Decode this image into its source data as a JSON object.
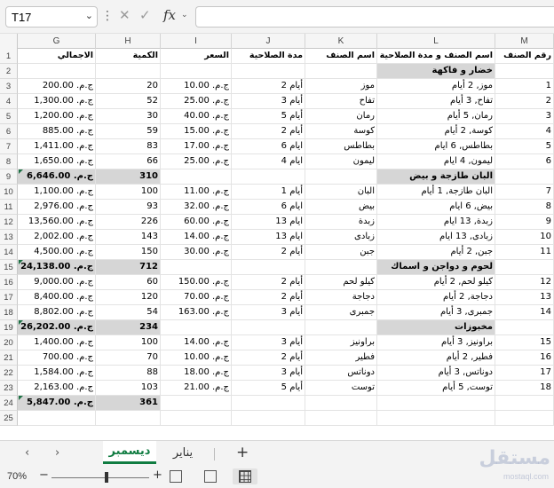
{
  "formula_bar": {
    "name_box": "T17",
    "fx": "fx",
    "formula": ""
  },
  "columns": [
    "G",
    "H",
    "I",
    "J",
    "K",
    "L",
    "M"
  ],
  "header_row": {
    "G": "الاجمالي",
    "H": "الكمية",
    "I": "السعر",
    "J": "مدة الصلاحية",
    "K": "اسم الصنف",
    "L": "اسم الصنف و مدة الصلاحية",
    "M": "رقم الصنف"
  },
  "rows": [
    {
      "n": "1",
      "type": "header"
    },
    {
      "n": "2",
      "type": "section",
      "L": "خضار و فاكهة"
    },
    {
      "n": "3",
      "type": "item",
      "G": "ج.م. 200.00",
      "H": "20",
      "I": "ج.م. 10.00",
      "J": "2 أيام",
      "K": "موز",
      "L": "موز, 2 أيام",
      "M": "1"
    },
    {
      "n": "4",
      "type": "item",
      "G": "ج.م. 1,300.00",
      "H": "52",
      "I": "ج.م. 25.00",
      "J": "3 أيام",
      "K": "تفاح",
      "L": "تفاح, 3 أيام",
      "M": "2"
    },
    {
      "n": "5",
      "type": "item",
      "G": "ج.م. 1,200.00",
      "H": "30",
      "I": "ج.م. 40.00",
      "J": "5 أيام",
      "K": "رمان",
      "L": "رمان, 5 أيام",
      "M": "3"
    },
    {
      "n": "6",
      "type": "item",
      "G": "ج.م. 885.00",
      "H": "59",
      "I": "ج.م. 15.00",
      "J": "2 أيام",
      "K": "كوسة",
      "L": "كوسة, 2 أيام",
      "M": "4"
    },
    {
      "n": "7",
      "type": "item",
      "G": "ج.م. 1,411.00",
      "H": "83",
      "I": "ج.م. 17.00",
      "J": "6 ايام",
      "K": "بطاطس",
      "L": "بطاطس, 6 ايام",
      "M": "5"
    },
    {
      "n": "8",
      "type": "item",
      "G": "ج.م. 1,650.00",
      "H": "66",
      "I": "ج.م. 25.00",
      "J": "4 ايام",
      "K": "ليمون",
      "L": "ليمون, 4 ايام",
      "M": "6"
    },
    {
      "n": "9",
      "type": "total",
      "G": "ج.م. 6,646.00",
      "H": "310",
      "L": "البان طازجة و بيض"
    },
    {
      "n": "10",
      "type": "item",
      "G": "ج.م. 1,100.00",
      "H": "100",
      "I": "ج.م. 11.00",
      "J": "1 أيام",
      "K": "البان",
      "L": "البان طازجة, 1 أيام",
      "M": "7"
    },
    {
      "n": "11",
      "type": "item",
      "G": "ج.م. 2,976.00",
      "H": "93",
      "I": "ج.م. 32.00",
      "J": "6 ايام",
      "K": "بيض",
      "L": "بيض, 6 ايام",
      "M": "8"
    },
    {
      "n": "12",
      "type": "item",
      "G": "ج.م. 13,560.00",
      "H": "226",
      "I": "ج.م. 60.00",
      "J": "13 ايام",
      "K": "زبدة",
      "L": "زبدة, 13 ايام",
      "M": "9"
    },
    {
      "n": "13",
      "type": "item",
      "G": "ج.م. 2,002.00",
      "H": "143",
      "I": "ج.م. 14.00",
      "J": "13 ايام",
      "K": "زبادى",
      "L": "زبادى, 13 ايام",
      "M": "10"
    },
    {
      "n": "14",
      "type": "item",
      "G": "ج.م. 4,500.00",
      "H": "150",
      "I": "ج.م. 30.00",
      "J": "2 أيام",
      "K": "جبن",
      "L": "جبن, 2 أيام",
      "M": "11"
    },
    {
      "n": "15",
      "type": "total",
      "G": "ج.م. 24,138.00",
      "H": "712",
      "L": "لحوم و دواجن و اسماك"
    },
    {
      "n": "16",
      "type": "item",
      "G": "ج.م. 9,000.00",
      "H": "60",
      "I": "ج.م. 150.00",
      "J": "2 أيام",
      "K": "كيلو لحم",
      "L": "كيلو لحم, 2 أيام",
      "M": "12"
    },
    {
      "n": "17",
      "type": "item",
      "G": "ج.م. 8,400.00",
      "H": "120",
      "I": "ج.م. 70.00",
      "J": "2 أيام",
      "K": "دجاجة",
      "L": "دجاجة, 2 أيام",
      "M": "13"
    },
    {
      "n": "18",
      "type": "item",
      "G": "ج.م. 8,802.00",
      "H": "54",
      "I": "ج.م. 163.00",
      "J": "3  أيام",
      "K": "جمبرى",
      "L": "جمبرى, 3  أيام",
      "M": "14"
    },
    {
      "n": "19",
      "type": "total",
      "G": "ج.م. 26,202.00",
      "H": "234",
      "L": "مخبوزات"
    },
    {
      "n": "20",
      "type": "item",
      "G": "ج.م. 1,400.00",
      "H": "100",
      "I": "ج.م. 14.00",
      "J": "3 أيام",
      "K": "براونيز",
      "L": "براونيز, 3 أيام",
      "M": "15"
    },
    {
      "n": "21",
      "type": "item",
      "G": "ج.م. 700.00",
      "H": "70",
      "I": "ج.م. 10.00",
      "J": "2 أيام",
      "K": "فطير",
      "L": "فطير, 2 أيام",
      "M": "16"
    },
    {
      "n": "22",
      "type": "item",
      "G": "ج.م. 1,584.00",
      "H": "88",
      "I": "ج.م. 18.00",
      "J": "3 أيام",
      "K": "دوناتس",
      "L": "دوناتس, 3 أيام",
      "M": "17"
    },
    {
      "n": "23",
      "type": "item",
      "G": "ج.م. 2,163.00",
      "H": "103",
      "I": "ج.م. 21.00",
      "J": "5 أيام",
      "K": "توست",
      "L": "توست, 5 أيام",
      "M": "18"
    },
    {
      "n": "24",
      "type": "total",
      "G": "ج.م. 5,847.00",
      "H": "361"
    },
    {
      "n": "25",
      "type": "empty"
    }
  ],
  "sheet_tabs": {
    "active": "ديسمبر",
    "other": "يناير"
  },
  "status": {
    "zoom": "70%"
  },
  "watermark": {
    "text": "مستقل",
    "sub": "mostaql.com"
  }
}
